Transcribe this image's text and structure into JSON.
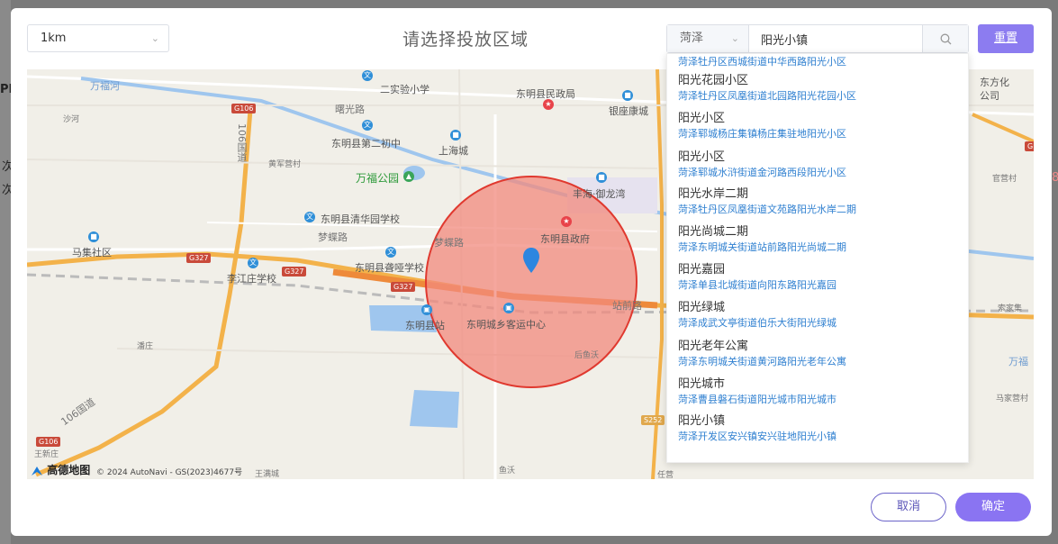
{
  "toolbar": {
    "radius_value": "1km",
    "title": "请选择投放区域",
    "city_value": "菏泽",
    "search_value": "阳光小镇",
    "reset_label": "重置"
  },
  "map": {
    "labels": {
      "yunfu_river": "万福河",
      "experiment_school": "二实验小学",
      "civil_affairs": "东明县民政局",
      "yinzuo": "银座康城",
      "shahe": "沙河",
      "shuguang_road": "曙光路",
      "no2_middle": "东明县第二初中",
      "shanghai_city": "上海城",
      "huangjun": "黄军营村",
      "wanfu_park": "万福公园",
      "yulong_bay": "丰海·御龙湾",
      "qinghua_school": "东明县清华园学校",
      "mengdie_road": "梦蝶路",
      "mengdie_road2": "梦蝶路",
      "gov": "东明县政府",
      "majia": "马集社区",
      "deaf_school": "东明县聋哑学校",
      "lijiang_school": "李江庄学校",
      "station": "东明县站",
      "bus_center": "东明城乡客运中心",
      "zhanqian_road": "站前路",
      "panzhuang": "潘庄",
      "houyu": "后鱼沃",
      "g106_road_vertical": "106国道",
      "g106_road_diag": "106国道",
      "wangxinzhuang": "王新庄",
      "yuwo": "鱼沃",
      "wangman": "王满城",
      "renying": "任营",
      "right_cut1": "东方化",
      "right_cut2": "公司",
      "guanying": "官营村",
      "suojia": "索家集",
      "wanfu_right": "万福",
      "maying": "马家营村"
    },
    "shields": {
      "g106_top": "G106",
      "g327_a": "G327",
      "g327_b": "G327",
      "g327_c": "G327",
      "g106_bottom": "G106",
      "s252": "S252",
      "g_right": "G"
    },
    "logo": "高德地图",
    "copyright": "© 2024 AutoNavi - GS(2023)4677号"
  },
  "results": [
    {
      "name": "",
      "addr": "菏泽牡丹区西城街道中华西路阳光小区"
    },
    {
      "name": "阳光花园小区",
      "addr": "菏泽牡丹区凤凰街道北园路阳光花园小区"
    },
    {
      "name": "阳光小区",
      "addr": "菏泽郓城杨庄集镇杨庄集驻地阳光小区"
    },
    {
      "name": "阳光小区",
      "addr": "菏泽郓城水浒街道金河路西段阳光小区"
    },
    {
      "name": "阳光水岸二期",
      "addr": "菏泽牡丹区凤凰街道文苑路阳光水岸二期"
    },
    {
      "name": "阳光尚城二期",
      "addr": "菏泽东明城关街道站前路阳光尚城二期"
    },
    {
      "name": "阳光嘉园",
      "addr": "菏泽单县北城街道向阳东路阳光嘉园"
    },
    {
      "name": "阳光绿城",
      "addr": "菏泽成武文亭街道伯乐大街阳光绿城"
    },
    {
      "name": "阳光老年公寓",
      "addr": "菏泽东明城关街道黄河路阳光老年公寓"
    },
    {
      "name": "阳光城市",
      "addr": "菏泽曹县磐石街道阳光城市阳光城市"
    },
    {
      "name": "阳光小镇",
      "addr": "菏泽开发区安兴镇安兴驻地阳光小镇"
    }
  ],
  "footer": {
    "cancel_label": "取消",
    "ok_label": "确定"
  },
  "background": {
    "left_text_a": "PM",
    "left_text_b": "次",
    "left_text_c": "次",
    "right_text": "8"
  },
  "colors": {
    "accent": "#8a74f2",
    "link": "#2e7fd0",
    "circle_fill": "#f28a7e",
    "circle_stroke": "#e0392f",
    "marker": "#2d86e0"
  }
}
